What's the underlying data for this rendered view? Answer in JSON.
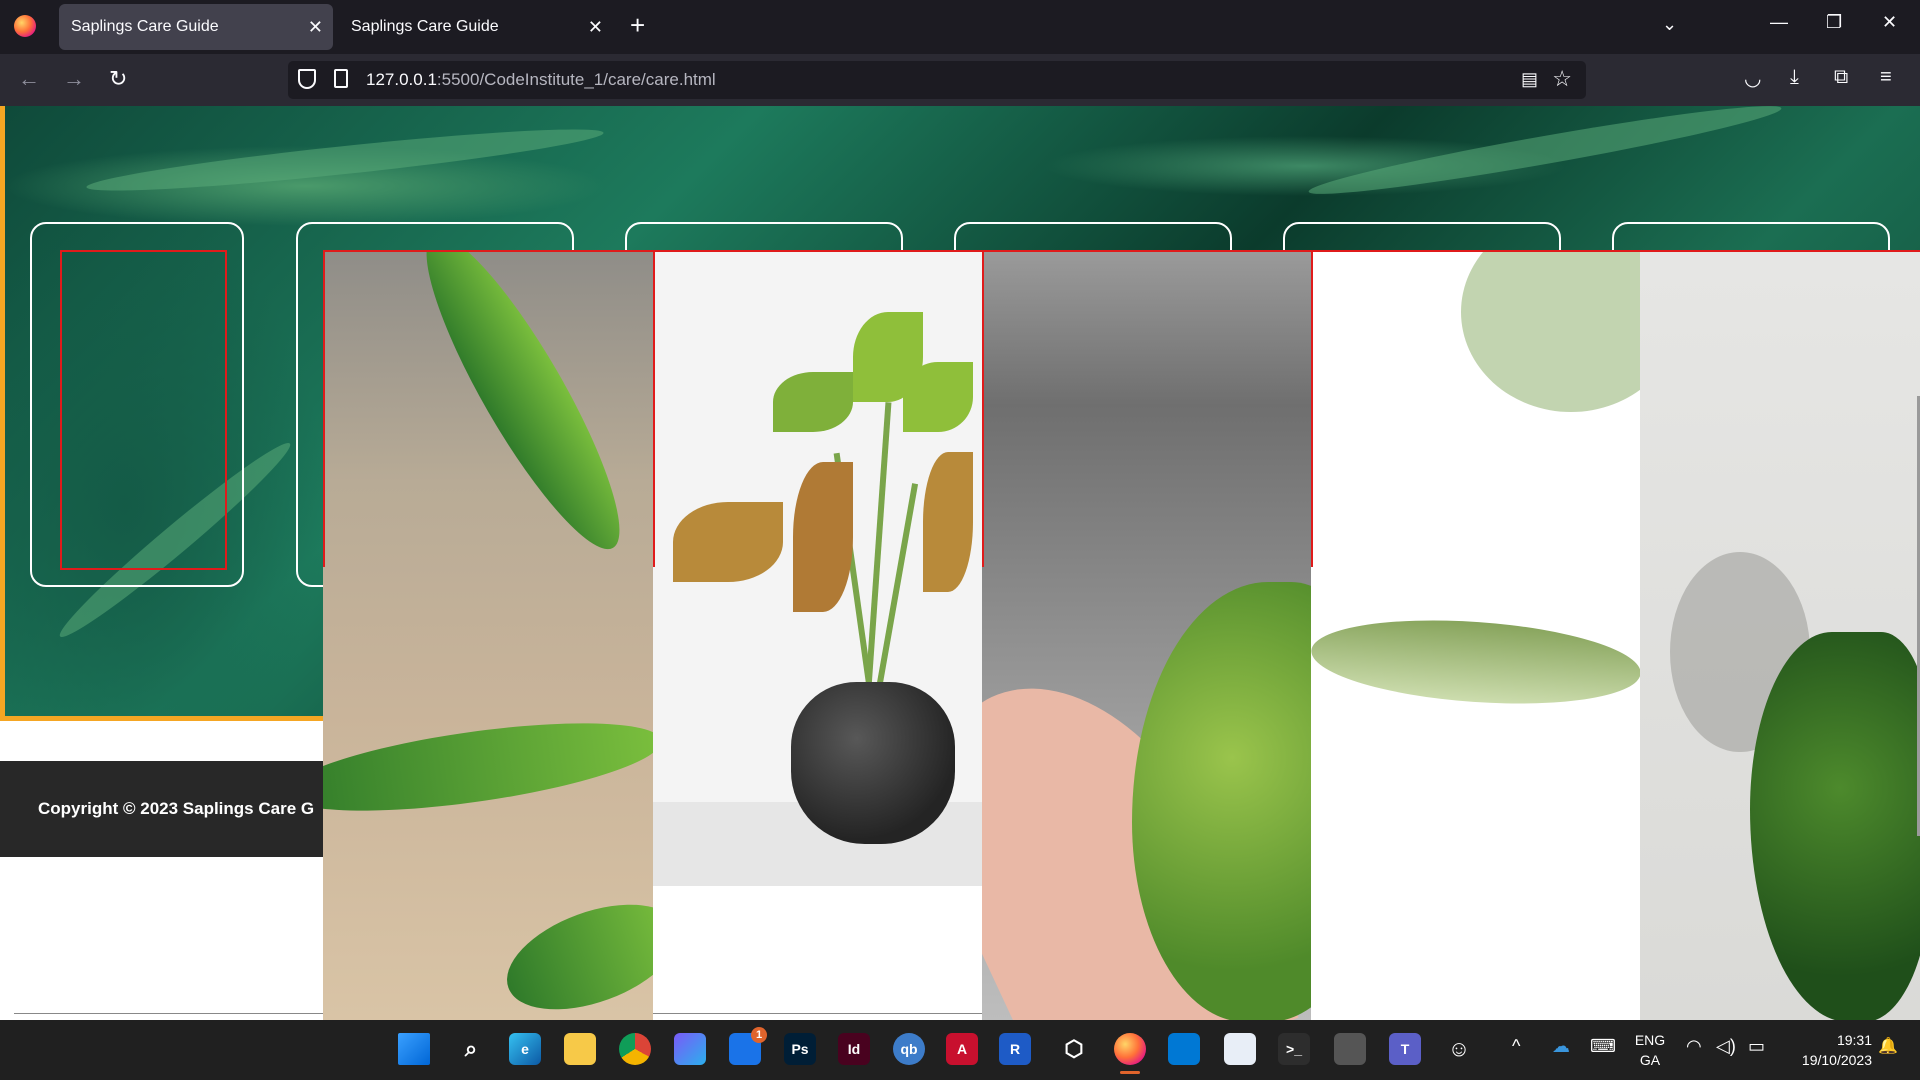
{
  "browser": {
    "tabs": [
      {
        "title": "Saplings Care Guide",
        "active": true
      },
      {
        "title": "Saplings Care Guide",
        "active": false
      }
    ],
    "new_tab_symbol": "+",
    "tab_list_symbol": "⌄",
    "close_symbol": "✕",
    "window_controls": {
      "minimize": "—",
      "restore": "❐",
      "close": "✕"
    },
    "nav": {
      "back": "←",
      "forward": "→",
      "reload": "↻"
    },
    "url": {
      "host": "127.0.0.1",
      "rest": ":5500/CodeInstitute_1/care/care.html"
    },
    "url_icons": [
      "shield-icon",
      "page-icon",
      "reader-view-icon",
      "bookmark-star-icon"
    ],
    "toolbar_icons": [
      "pocket-icon",
      "downloads-icon",
      "extensions-icon",
      "menu-icon"
    ],
    "reader_symbol": "▤",
    "star_symbol": "☆",
    "toolbar_symbols": {
      "pocket": "◡",
      "downloads": "⤓",
      "extensions": "⧉",
      "menu": "≡"
    }
  },
  "page": {
    "footer": {
      "copyright": "Copyright © 2023 Saplings Care G"
    },
    "accent_color": "#f5a623",
    "outline_color": "#e01b1b"
  },
  "taskbar": {
    "apps": [
      {
        "name": "start-icon",
        "label": ""
      },
      {
        "name": "search-icon",
        "label": "⌕"
      },
      {
        "name": "edge-icon",
        "label": "e"
      },
      {
        "name": "file-explorer-icon",
        "label": ""
      },
      {
        "name": "chrome-icon",
        "label": ""
      },
      {
        "name": "copilot-icon",
        "label": ""
      },
      {
        "name": "mail-icon",
        "label": "",
        "badge": "1"
      },
      {
        "name": "photoshop-icon",
        "label": "Ps"
      },
      {
        "name": "indesign-icon",
        "label": "Id"
      },
      {
        "name": "qbittorrent-icon",
        "label": "qb"
      },
      {
        "name": "autocad-icon",
        "label": "A"
      },
      {
        "name": "revit-icon",
        "label": "R"
      },
      {
        "name": "virtualbox-icon",
        "label": "⬡"
      },
      {
        "name": "firefox-icon",
        "label": "",
        "active": true
      },
      {
        "name": "vscode-icon",
        "label": ""
      },
      {
        "name": "notepad-icon",
        "label": ""
      },
      {
        "name": "terminal-icon",
        "label": ">_"
      },
      {
        "name": "inkscape-icon",
        "label": ""
      },
      {
        "name": "teams-icon",
        "label": "T"
      },
      {
        "name": "emoji-icon",
        "label": "☺"
      }
    ],
    "tray": {
      "chevron": "^",
      "language": {
        "line1": "ENG",
        "line2": "GA"
      },
      "time": "19:31",
      "date": "19/10/2023",
      "symbols": {
        "wifi": "◠",
        "volume": "◁)",
        "battery": "▭",
        "keyboard": "⌨",
        "notifications": "🔔"
      }
    }
  }
}
